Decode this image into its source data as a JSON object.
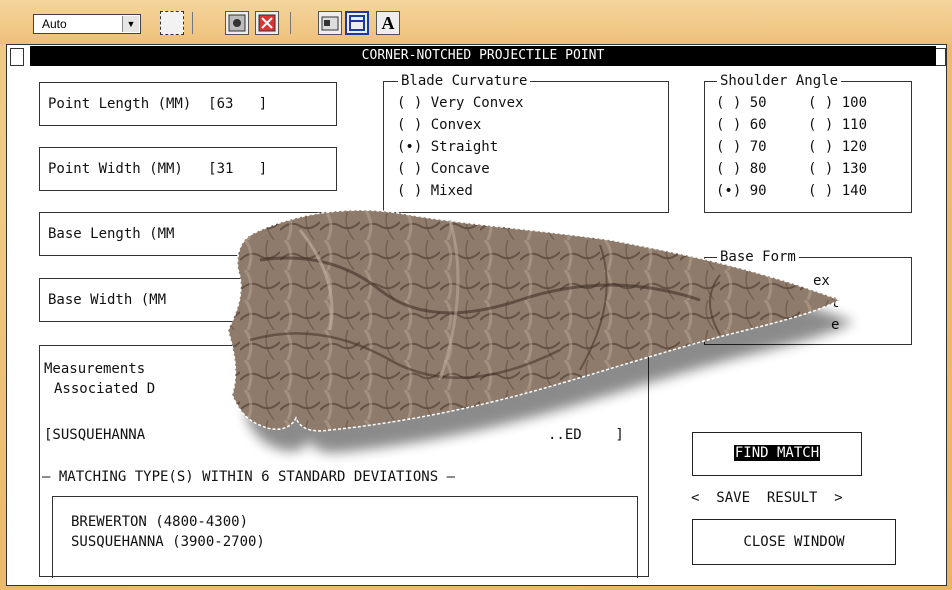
{
  "toolbar": {
    "zoom_value": "Auto",
    "text_tool_label": "A"
  },
  "window": {
    "title": "CORNER-NOTCHED PROJECTILE POINT"
  },
  "fields": {
    "point_length": "Point Length (MM)  [63   ]",
    "point_width": "Point Width (MM)   [31   ]",
    "base_length": "Base Length (MM",
    "base_width": "Base Width (MM"
  },
  "blade_curvature": {
    "title": "Blade Curvature",
    "options": [
      "( ) Very Convex",
      "( ) Convex",
      "(•) Straight",
      "( ) Concave",
      "( ) Mixed"
    ]
  },
  "shoulder_angle": {
    "title": "Shoulder Angle",
    "left_options": [
      "( ) 50",
      "( ) 60",
      "( ) 70",
      "( ) 80",
      "(•) 90"
    ],
    "right_options": [
      "( ) 100",
      "( ) 110",
      "( ) 120",
      "( ) 130",
      "( ) 140"
    ]
  },
  "base_form": {
    "title": "Base Form",
    "visible_fragments": [
      "ex",
      "t",
      "e"
    ]
  },
  "measurements": {
    "line1": "Measurements",
    "line2": "Associated D",
    "type_field": "[SUSQUEHANNA",
    "type_field_tail": "..ED    ]",
    "matching_header": "— MATCHING TYPE(S) WITHIN 6 STANDARD DEVIATIONS —",
    "matches": [
      "BREWERTON (4800-4300)",
      "SUSQUEHANNA (3900-2700)"
    ]
  },
  "actions": {
    "find_match": "FIND MATCH",
    "save_result": "<  SAVE  RESULT  >",
    "close_window": "CLOSE WINDOW"
  }
}
